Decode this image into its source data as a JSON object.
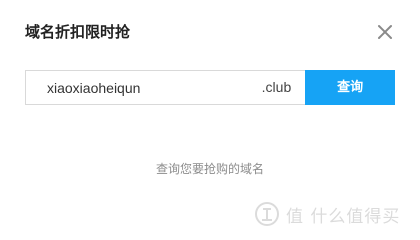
{
  "dialog": {
    "title": "域名折扣限时抢",
    "close_icon": "close-icon"
  },
  "search": {
    "value": "xiaoxiaoheiqun",
    "suffix": ".club",
    "button_label": "查询"
  },
  "hint": "查询您要抢购的域名",
  "watermark": {
    "text": "值 什么值得买",
    "icon": "zhi-logo-icon"
  },
  "colors": {
    "accent": "#16a3f5",
    "hint_text": "#8c8c8c",
    "border": "#d9d9d9"
  }
}
